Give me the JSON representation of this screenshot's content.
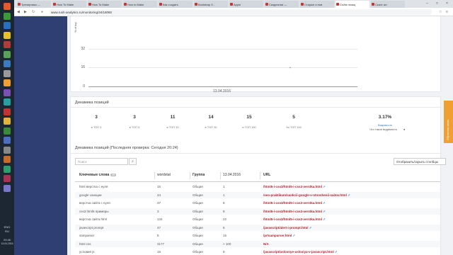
{
  "browser": {
    "tabs": [
      "Тренировка —",
      "How To Make",
      "How To Make",
      "How to Make",
      "Как создать",
      "Bootstrap 3 -",
      "Apple",
      "Скидочная —",
      "Старые и нов",
      "Съём позиц",
      "Скачт шт"
    ],
    "active_tab_index": 9,
    "url": "www.rush-analytics.ru/monitoring/34/18080",
    "window_controls": [
      "–",
      "□",
      "×"
    ]
  },
  "taskbar": {
    "tray_lines": [
      "ENG",
      "RU",
      "20:46",
      "13.04.2016"
    ],
    "icon_colors": [
      "#e35b2b",
      "#3a9a3a",
      "#2a6ebf",
      "#e8c02a",
      "#b43a3a",
      "#5aa05a",
      "#3b7bbf",
      "#999999",
      "#f0a033",
      "#7b4fb4",
      "#26a1a1",
      "#c33333",
      "#e2b53a",
      "#3a8a3a",
      "#4a6fc2",
      "#888888",
      "#c86b2a",
      "#2f9e6c",
      "#aa3355",
      "#7777cc"
    ]
  },
  "chart_data": {
    "type": "line",
    "ylabel": "% of top",
    "yticks": [
      "32",
      "16",
      "0"
    ],
    "ylim": [
      0,
      40
    ],
    "x": [
      "13.04.2016"
    ],
    "series": [
      {
        "values": [
          16
        ]
      }
    ],
    "grid": true
  },
  "dynamics": {
    "title": "Динамика позиций",
    "stats": [
      {
        "value": "3",
        "label": "в ТОП 3"
      },
      {
        "value": "3",
        "label": "в ТОП 5"
      },
      {
        "value": "11",
        "label": "в ТОП 10"
      },
      {
        "value": "14",
        "label": "в ТОП 30"
      },
      {
        "value": "15",
        "label": "в ТОП 100"
      },
      {
        "value": "5",
        "label": "За ТОП 100"
      }
    ],
    "visibility": {
      "value": "3.17%",
      "label": "Видимость",
      "help": "Что такое видимость"
    }
  },
  "table_card": {
    "title": "Динамика позиций (Последняя проверка: Сегодня 20:24)",
    "search_placeholder": "Поиск",
    "search_icon": "search-icon",
    "columns_button": "Отобразить/скрыть столбцы",
    "headers": {
      "keywords": "Ключевые слова",
      "keywords_count": "20",
      "wordstat": "wordstat",
      "group": "Группа",
      "date": "13.04.2016",
      "url": "URL"
    },
    "rows": [
      {
        "kw": "html верстка с нуля",
        "ws": "15",
        "group": "Общая",
        "pos": "1",
        "url": "/html5-i-css3/html5-i-css3-verstka.html"
      },
      {
        "kw": "google санкции",
        "ws": "24",
        "group": "Общая",
        "pos": "1",
        "url": "/seo-praktikum/sankcii-google-v-otnoshenii-saitov.html"
      },
      {
        "kw": "верстка сайта с нуля",
        "ws": "37",
        "group": "Общая",
        "pos": "8",
        "url": "/html5-i-css3/html5-i-css3-verstka.html"
      },
      {
        "kw": "css3 html5 примеры",
        "ws": "3",
        "group": "Общая",
        "pos": "9",
        "url": "/html5-i-css3/html5-i-css3-verstka.html"
      },
      {
        "kw": "верстка сайта html",
        "ws": "134",
        "group": "Общая",
        "pos": "22",
        "url": "/html5-i-css3/html5-i-css3-verstka.html"
      },
      {
        "kw": "javascript prompt",
        "ws": "47",
        "group": "Общая",
        "pos": "6",
        "url": "/javascript/alert-i-prompt.html"
      },
      {
        "kw": "samparser",
        "ws": "8",
        "group": "Общая",
        "pos": "15",
        "url": "/pr/samparser.html"
      },
      {
        "kw": "html css",
        "ws": "3177",
        "group": "Общая",
        "pos": "> 100",
        "url": "N/A"
      },
      {
        "kw": "условия js",
        "ws": "15",
        "group": "Общая",
        "pos": "9",
        "url": "/javascript/uslovnye-usloviya-v-javascript.html"
      }
    ]
  },
  "feedback_tab": "Обратная связь"
}
